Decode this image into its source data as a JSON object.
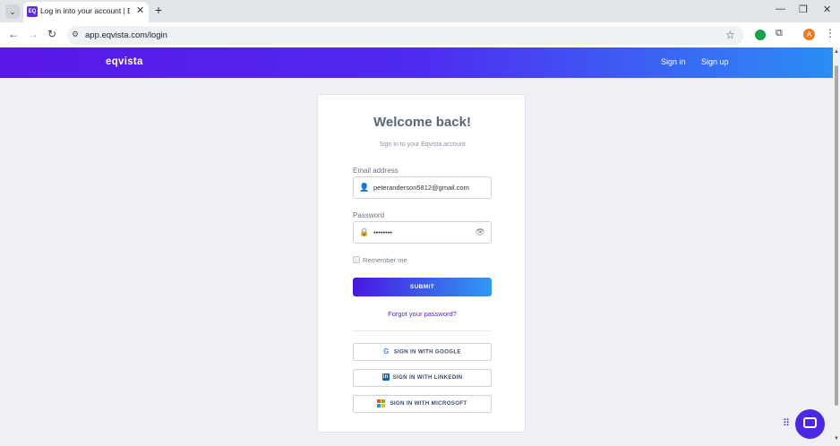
{
  "browser": {
    "tab_title": "Log in into your account | Eqvista",
    "tab_favicon": "EQ",
    "tab_close": "✕",
    "new_tab": "+",
    "minimize": "—",
    "restore": "❐",
    "close": "✕",
    "url": "app.eqvista.com/login",
    "profile_initial": "A"
  },
  "header": {
    "logo": "eqvista",
    "signin_link": "Sign in",
    "signup_link": "Sign up"
  },
  "form": {
    "title": "Welcome back!",
    "subtitle": "Sign in to your Eqvista account",
    "email_label": "Email address",
    "email_value": "peteranderson5812@gmail.com",
    "password_label": "Password",
    "password_value": "••••••••",
    "remember_label": "Remember me",
    "submit_label": "SUBMIT",
    "forgot_link": "Forgot your password?"
  },
  "social": {
    "google_label": "SIGN IN WITH GOOGLE",
    "linkedin_label": "SIGN IN WITH LINKEDIN",
    "microsoft_label": "SIGN IN WITH MICROSOFT"
  },
  "colors": {
    "brand_purple": "#5a17e6",
    "brand_blue": "#2c8df5",
    "link_purple": "#5b21d9"
  }
}
